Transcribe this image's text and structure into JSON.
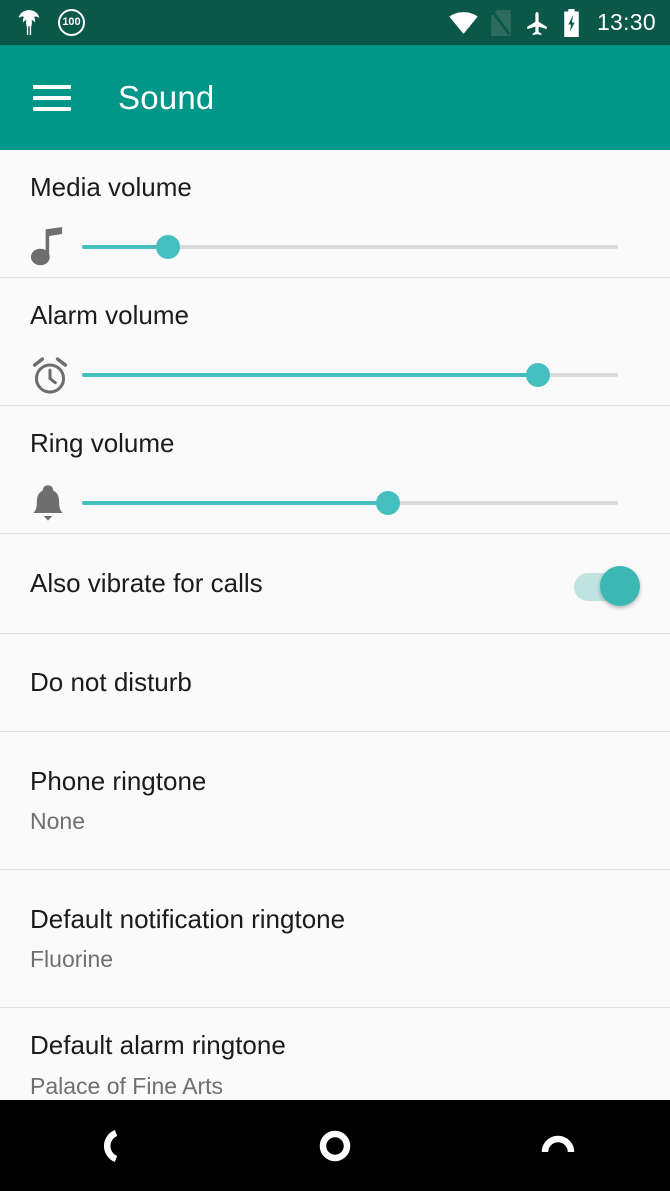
{
  "status_bar": {
    "background": "#0b5749",
    "left_icons": [
      {
        "name": "magisk-icon",
        "label": "Magisk"
      },
      {
        "name": "battery-percent-badge",
        "label": "100"
      }
    ],
    "right_icons": [
      {
        "name": "wifi-icon",
        "label": "Wi-Fi"
      },
      {
        "name": "no-sim-icon",
        "label": "No SIM"
      },
      {
        "name": "airplane-mode-icon",
        "label": "Airplane mode"
      },
      {
        "name": "battery-charging-icon",
        "label": "Charging"
      }
    ],
    "clock": "13:30"
  },
  "app_bar": {
    "title": "Sound",
    "menu_icon": "hamburger-icon",
    "background": "#009688"
  },
  "accent_color": "#45bfc0",
  "settings": [
    {
      "type": "slider",
      "title": "Media volume",
      "icon": "music-note-icon",
      "value_percent": 16
    },
    {
      "type": "slider",
      "title": "Alarm volume",
      "icon": "alarm-clock-icon",
      "value_percent": 85
    },
    {
      "type": "slider",
      "title": "Ring volume",
      "icon": "bell-icon",
      "value_percent": 57
    },
    {
      "type": "switch",
      "title": "Also vibrate for calls",
      "checked": true
    },
    {
      "type": "nav",
      "title": "Do not disturb",
      "summary": ""
    },
    {
      "type": "two_line",
      "title": "Phone ringtone",
      "summary": "None"
    },
    {
      "type": "two_line",
      "title": "Default notification ringtone",
      "summary": "Fluorine"
    },
    {
      "type": "two_line_clipped",
      "title": "Default alarm ringtone",
      "summary": "Palace of Fine Arts"
    }
  ],
  "nav_bar": {
    "background": "#000000",
    "buttons": [
      {
        "name": "back-button",
        "label": "Back"
      },
      {
        "name": "home-button",
        "label": "Home"
      },
      {
        "name": "recents-button",
        "label": "Recents"
      }
    ]
  }
}
